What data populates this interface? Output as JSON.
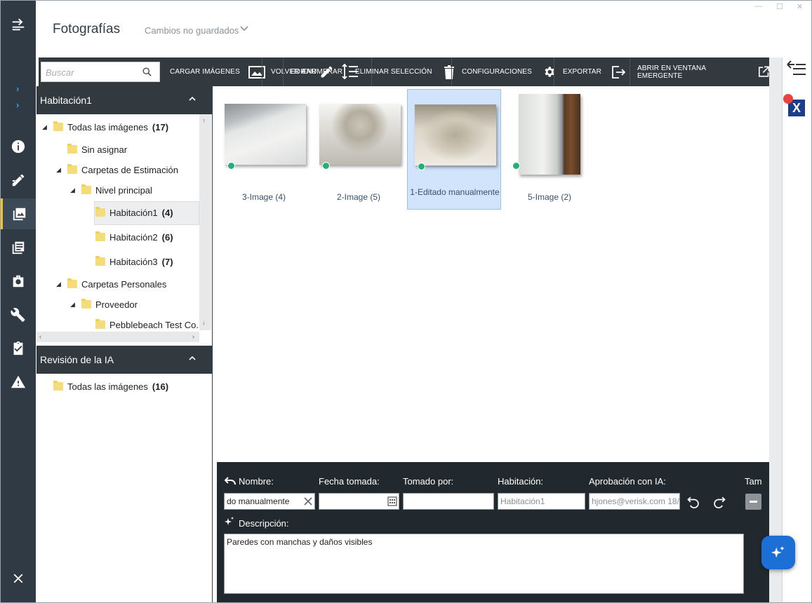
{
  "header": {
    "title": "Fotografías",
    "status": "Cambios no guardados"
  },
  "toolbar": {
    "search_placeholder": "Buscar",
    "upload_label": "CARGAR IMÁGENES",
    "renumber_label_a": "VOLVER A",
    "renumber_label_b": "ENUMERAR",
    "rename_label": "EDITAR",
    "delete_label": "ELIMINAR SELECCIÓN",
    "settings_label": "CONFIGURACIONES",
    "export_label": "EXPORTAR",
    "popup_label": "ABRIR EN VENTANA EMERGENTE"
  },
  "tree_section": {
    "title": "Habitación1",
    "rows": [
      {
        "label": "Todas las imágenes",
        "count": "(17)"
      },
      {
        "label": "Sin asignar",
        "count": ""
      },
      {
        "label": "Carpetas de Estimación",
        "count": ""
      },
      {
        "label": "Nivel principal",
        "count": ""
      },
      {
        "label": "Habitación1",
        "count": "(4)"
      },
      {
        "label": "Habitación2",
        "count": "(6)"
      },
      {
        "label": "Habitación3",
        "count": "(7)"
      },
      {
        "label": "Carpetas Personales",
        "count": ""
      },
      {
        "label": "Proveedor",
        "count": ""
      },
      {
        "label": "Pebblebeach Test Co.",
        "count": ""
      }
    ]
  },
  "ai_section": {
    "title": "Revisión de la IA",
    "rows": [
      {
        "label": "Todas las imágenes",
        "count": "(16)"
      }
    ]
  },
  "photos": [
    {
      "caption": "3-Image (4)",
      "selected": false
    },
    {
      "caption": "2-Image (5)",
      "selected": false
    },
    {
      "caption": "1-Editado manualmente",
      "selected": true
    },
    {
      "caption": "5-Image (2)",
      "selected": false
    }
  ],
  "details": {
    "name_label": "Nombre:",
    "name_value": "do manualmente",
    "date_label": "Fecha tomada:",
    "date_value": "",
    "taken_by_label": "Tomado por:",
    "taken_by_value": "",
    "room_label": "Habitación:",
    "room_value": "Habitación1",
    "ai_approval_label": "Aprobación con IA:",
    "ai_approval_value": "hjones@verisk.com 18/0",
    "size_label": "Tam",
    "description_label": "Descripción:",
    "description_value": "Paredes con manchas y daños visibles"
  },
  "colors": {
    "rail_bg": "#2f3a45",
    "toolbar_bg": "#323a40",
    "accent_active": "#f4c430",
    "status_dot": "#22b07a",
    "selected_card": "#d2e4fb",
    "ai_button": "#1c6fd4"
  }
}
